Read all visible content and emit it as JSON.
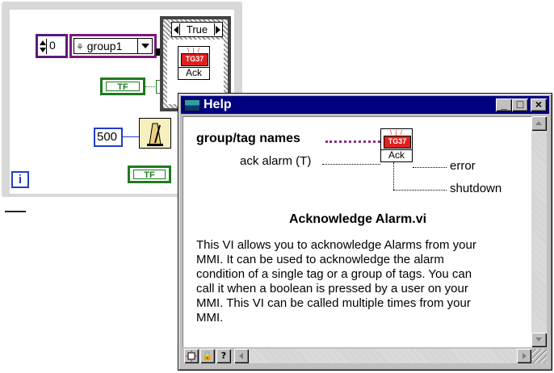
{
  "diagram": {
    "numeric_value": "0",
    "tag_value": "group1",
    "bool_label_1": "TF",
    "bool_label_2": "TF",
    "wait_ms": "500",
    "iteration_label": "i",
    "case_label": "True",
    "vi_badge": "TG37",
    "vi_label": "Ack"
  },
  "help_window": {
    "title": "Help",
    "min_glyph": "_",
    "max_glyph": "□",
    "close_glyph": "×",
    "connector": {
      "vi_badge": "TG37",
      "vi_label": "Ack",
      "inputs": [
        "group/tag names",
        "ack alarm (T)"
      ],
      "outputs": [
        "error",
        "shutdown"
      ]
    },
    "vi_name": "Acknowledge Alarm.vi",
    "description": "This VI allows you to acknowledge Alarms from your\nMMI.  It can be used to acknowledge the alarm\ncondition of a single tag or a group of tags.  You can\ncall it when a boolean is pressed by a user on your\nMMI. This VI can be called multiple times from your\nMMI.",
    "bottom_buttons": {
      "lock_glyph": "🔒",
      "help_glyph": "?"
    }
  },
  "colors": {
    "title_bar": "#000080",
    "window_face": "#c0c0c0",
    "tag_wire": "#8a2b8a",
    "bool_wire": "#1f7a1f",
    "numeric_border": "#1f3ec8",
    "alarm_badge": "#e02020"
  }
}
